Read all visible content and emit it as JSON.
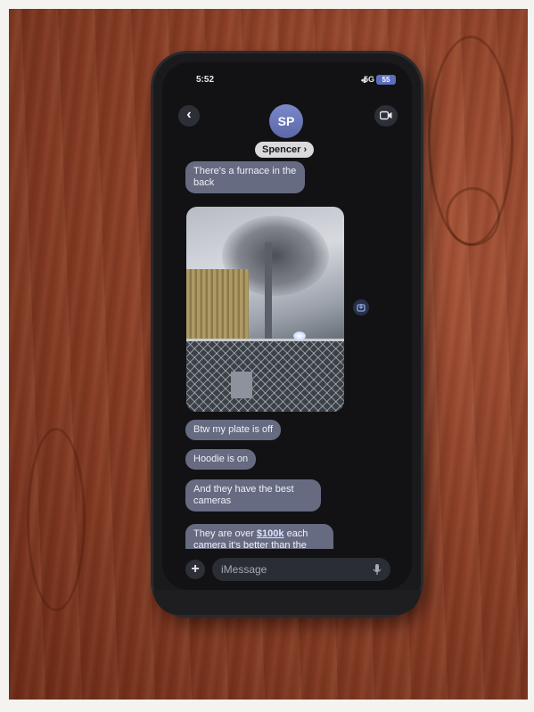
{
  "status_bar": {
    "time": "5:52",
    "signal": "•ıl",
    "network": "5G",
    "battery": "55"
  },
  "header": {
    "avatar_initials": "SP",
    "contact_name": "Spencer",
    "back_icon": "chevron-left-icon",
    "video_icon": "video-camera-icon"
  },
  "messages": [
    {
      "text": "There's a furnace in the back"
    },
    {
      "text": "Btw my plate is off"
    },
    {
      "text": "Hoodie is on"
    },
    {
      "text": "And they have the best cameras"
    },
    {
      "text_before": "They are over ",
      "link": "$100k",
      "text_after": " each camera it's better than the"
    }
  ],
  "input": {
    "placeholder": "iMessage",
    "plus_icon": "plus-icon",
    "mic_icon": "microphone-icon"
  },
  "colors": {
    "bubble": "#666b82",
    "wood": "#8c3f27",
    "phone": "#1a1a1c"
  }
}
